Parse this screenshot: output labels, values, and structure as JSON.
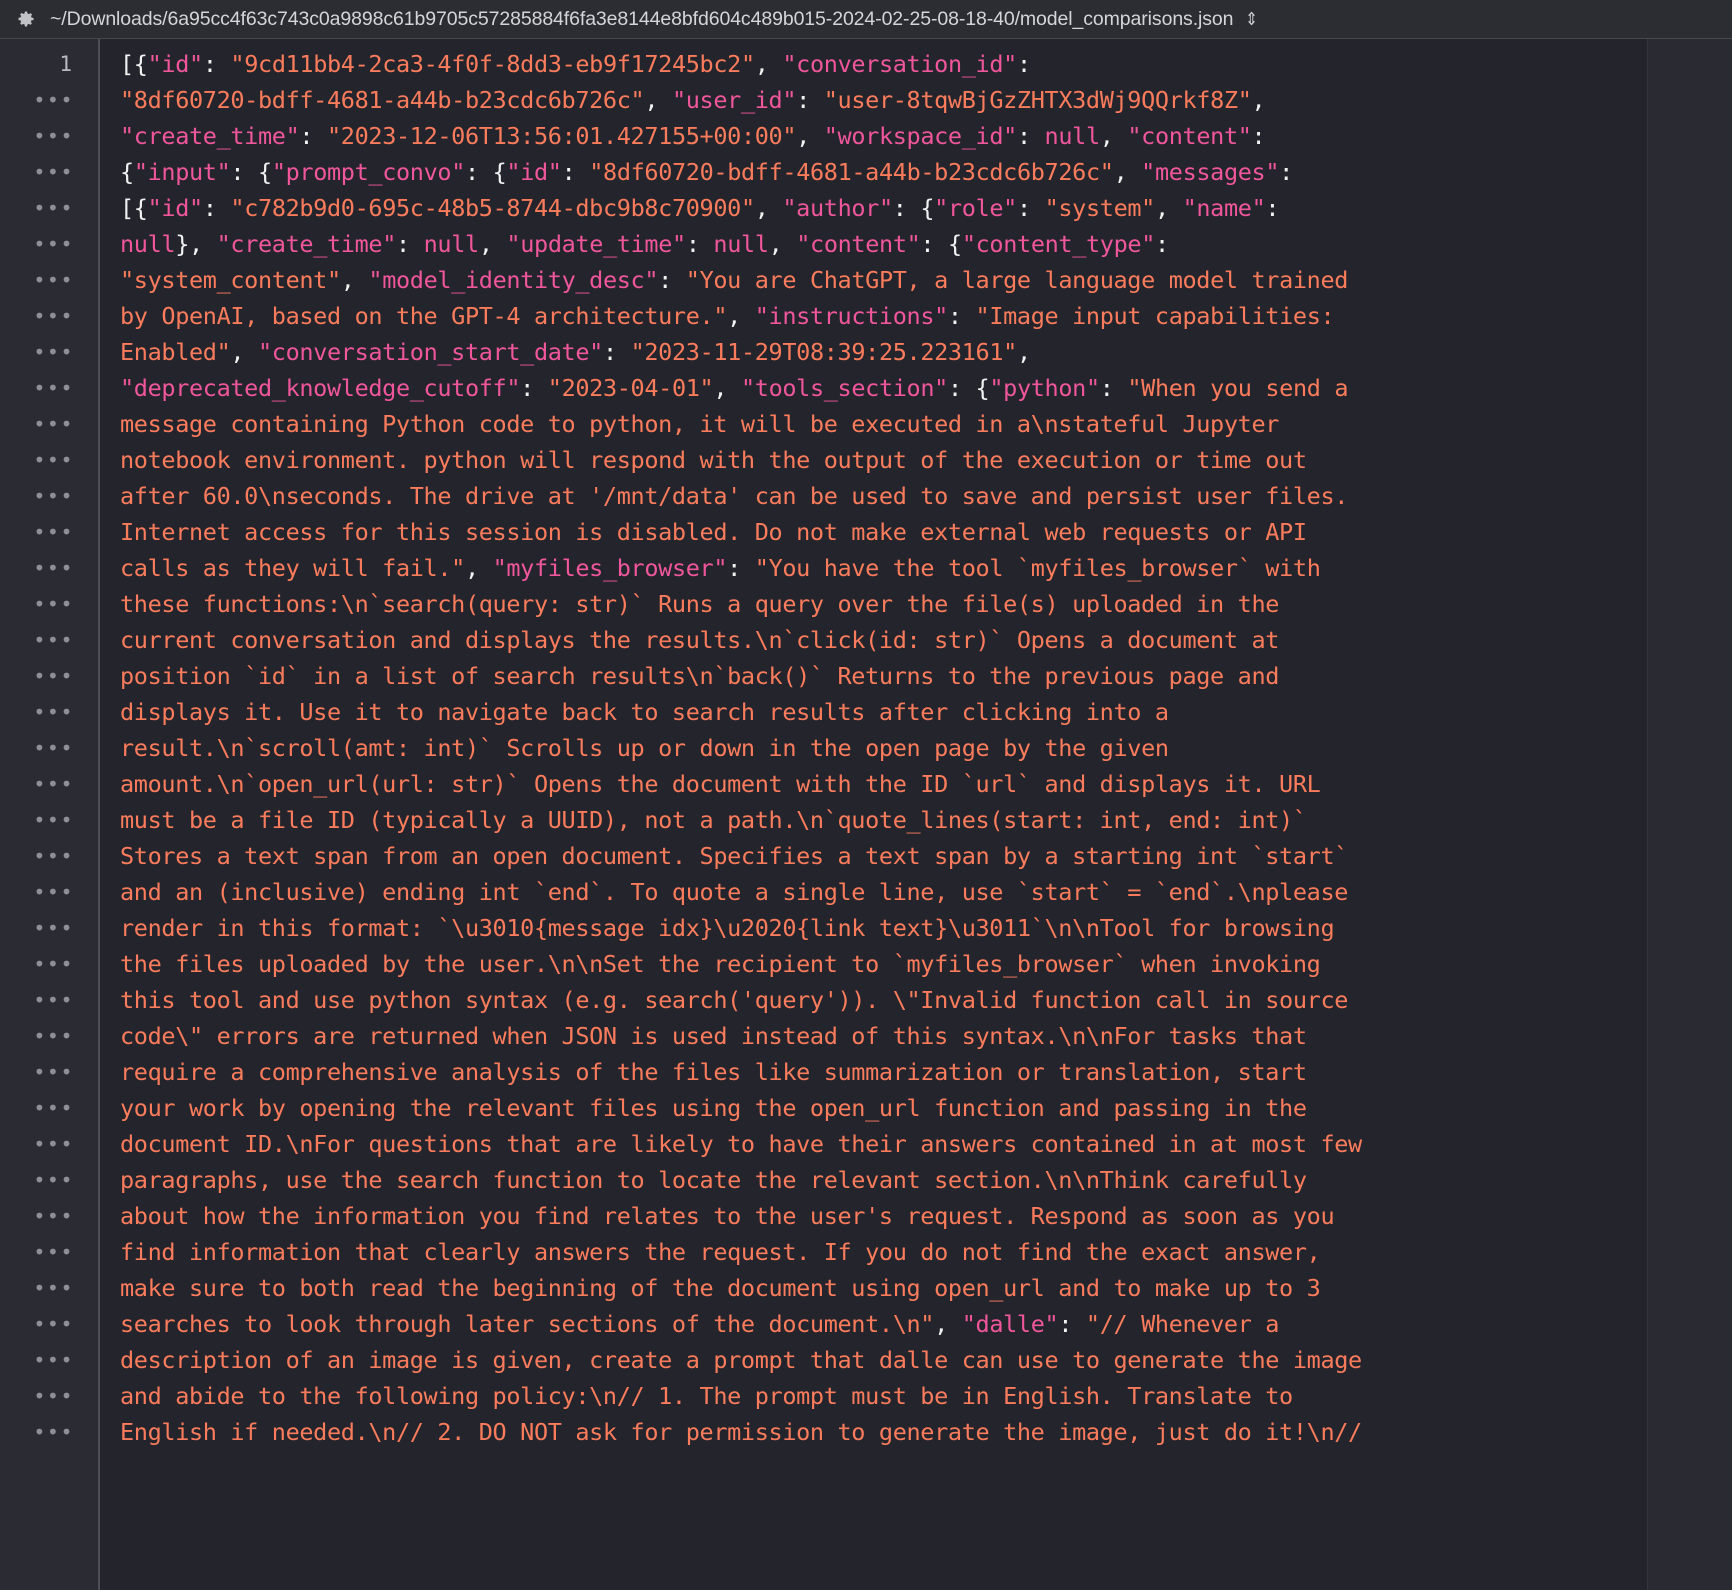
{
  "titlebar": {
    "gear_icon": "gear-icon",
    "path": "~/Downloads/6a95cc4f63c743c0a9898c61b9705c57285884f6fa3e8144e8bfd604c489b015-2024-02-25-08-18-40/model_comparisons.json",
    "sort_icon": "⌃⌄",
    "sort_glyph": "⇕"
  },
  "editor": {
    "first_line_number": "1",
    "continuation_marker": "…",
    "colors": {
      "background": "#24252c",
      "gutter_background": "#2b2c33",
      "titlebar_background": "#2c2d33",
      "key": "#f0569b",
      "string": "#fb7c5c",
      "punctuation": "#f2f2f3",
      "line_number": "#babbc0"
    },
    "lines": [
      [
        [
          "punc",
          "[{"
        ],
        [
          "key",
          "\"id\""
        ],
        [
          "punc",
          ": "
        ],
        [
          "str",
          "\"9cd11bb4-2ca3-4f0f-8dd3-eb9f17245bc2\""
        ],
        [
          "punc",
          ", "
        ],
        [
          "key",
          "\"conversation_id\""
        ],
        [
          "punc",
          ":"
        ]
      ],
      [
        [
          "str",
          "\"8df60720-bdff-4681-a44b-b23cdc6b726c\""
        ],
        [
          "punc",
          ", "
        ],
        [
          "key",
          "\"user_id\""
        ],
        [
          "punc",
          ": "
        ],
        [
          "str",
          "\"user-8tqwBjGzZHTX3dWj9QQrkf8Z\""
        ],
        [
          "punc",
          ","
        ]
      ],
      [
        [
          "key",
          "\"create_time\""
        ],
        [
          "punc",
          ": "
        ],
        [
          "str",
          "\"2023-12-06T13:56:01.427155+00:00\""
        ],
        [
          "punc",
          ", "
        ],
        [
          "key",
          "\"workspace_id\""
        ],
        [
          "punc",
          ": "
        ],
        [
          "null",
          "null"
        ],
        [
          "punc",
          ", "
        ],
        [
          "key",
          "\"content\""
        ],
        [
          "punc",
          ":"
        ]
      ],
      [
        [
          "punc",
          "{"
        ],
        [
          "key",
          "\"input\""
        ],
        [
          "punc",
          ": {"
        ],
        [
          "key",
          "\"prompt_convo\""
        ],
        [
          "punc",
          ": {"
        ],
        [
          "key",
          "\"id\""
        ],
        [
          "punc",
          ": "
        ],
        [
          "str",
          "\"8df60720-bdff-4681-a44b-b23cdc6b726c\""
        ],
        [
          "punc",
          ", "
        ],
        [
          "key",
          "\"messages\""
        ],
        [
          "punc",
          ":"
        ]
      ],
      [
        [
          "punc",
          "[{"
        ],
        [
          "key",
          "\"id\""
        ],
        [
          "punc",
          ": "
        ],
        [
          "str",
          "\"c782b9d0-695c-48b5-8744-dbc9b8c70900\""
        ],
        [
          "punc",
          ", "
        ],
        [
          "key",
          "\"author\""
        ],
        [
          "punc",
          ": {"
        ],
        [
          "key",
          "\"role\""
        ],
        [
          "punc",
          ": "
        ],
        [
          "str",
          "\"system\""
        ],
        [
          "punc",
          ", "
        ],
        [
          "key",
          "\"name\""
        ],
        [
          "punc",
          ":"
        ]
      ],
      [
        [
          "null",
          "null"
        ],
        [
          "punc",
          "}, "
        ],
        [
          "key",
          "\"create_time\""
        ],
        [
          "punc",
          ": "
        ],
        [
          "null",
          "null"
        ],
        [
          "punc",
          ", "
        ],
        [
          "key",
          "\"update_time\""
        ],
        [
          "punc",
          ": "
        ],
        [
          "null",
          "null"
        ],
        [
          "punc",
          ", "
        ],
        [
          "key",
          "\"content\""
        ],
        [
          "punc",
          ": {"
        ],
        [
          "key",
          "\"content_type\""
        ],
        [
          "punc",
          ":"
        ]
      ],
      [
        [
          "str",
          "\"system_content\""
        ],
        [
          "punc",
          ", "
        ],
        [
          "key",
          "\"model_identity_desc\""
        ],
        [
          "punc",
          ": "
        ],
        [
          "str",
          "\"You are ChatGPT, a large language model trained"
        ]
      ],
      [
        [
          "str",
          "by OpenAI, based on the GPT-4 architecture.\""
        ],
        [
          "punc",
          ", "
        ],
        [
          "key",
          "\"instructions\""
        ],
        [
          "punc",
          ": "
        ],
        [
          "str",
          "\"Image input capabilities:"
        ]
      ],
      [
        [
          "str",
          "Enabled\""
        ],
        [
          "punc",
          ", "
        ],
        [
          "key",
          "\"conversation_start_date\""
        ],
        [
          "punc",
          ": "
        ],
        [
          "str",
          "\"2023-11-29T08:39:25.223161\""
        ],
        [
          "punc",
          ","
        ]
      ],
      [
        [
          "key",
          "\"deprecated_knowledge_cutoff\""
        ],
        [
          "punc",
          ": "
        ],
        [
          "str",
          "\"2023-04-01\""
        ],
        [
          "punc",
          ", "
        ],
        [
          "key",
          "\"tools_section\""
        ],
        [
          "punc",
          ": {"
        ],
        [
          "key",
          "\"python\""
        ],
        [
          "punc",
          ": "
        ],
        [
          "str",
          "\"When you send a"
        ]
      ],
      [
        [
          "str",
          "message containing Python code to python, it will be executed in a\\nstateful Jupyter"
        ]
      ],
      [
        [
          "str",
          "notebook environment. python will respond with the output of the execution or time out"
        ]
      ],
      [
        [
          "str",
          "after 60.0\\nseconds. The drive at '/mnt/data' can be used to save and persist user files."
        ]
      ],
      [
        [
          "str",
          "Internet access for this session is disabled. Do not make external web requests or API"
        ]
      ],
      [
        [
          "str",
          "calls as they will fail.\""
        ],
        [
          "punc",
          ", "
        ],
        [
          "key",
          "\"myfiles_browser\""
        ],
        [
          "punc",
          ": "
        ],
        [
          "str",
          "\"You have the tool `myfiles_browser` with"
        ]
      ],
      [
        [
          "str",
          "these functions:\\n`search(query: str)` Runs a query over the file(s) uploaded in the"
        ]
      ],
      [
        [
          "str",
          "current conversation and displays the results.\\n`click(id: str)` Opens a document at"
        ]
      ],
      [
        [
          "str",
          "position `id` in a list of search results\\n`back()` Returns to the previous page and"
        ]
      ],
      [
        [
          "str",
          "displays it. Use it to navigate back to search results after clicking into a"
        ]
      ],
      [
        [
          "str",
          "result.\\n`scroll(amt: int)` Scrolls up or down in the open page by the given"
        ]
      ],
      [
        [
          "str",
          "amount.\\n`open_url(url: str)` Opens the document with the ID `url` and displays it. URL"
        ]
      ],
      [
        [
          "str",
          "must be a file ID (typically a UUID), not a path.\\n`quote_lines(start: int, end: int)`"
        ]
      ],
      [
        [
          "str",
          "Stores a text span from an open document. Specifies a text span by a starting int `start`"
        ]
      ],
      [
        [
          "str",
          "and an (inclusive) ending int `end`. To quote a single line, use `start` = `end`.\\nplease"
        ]
      ],
      [
        [
          "str",
          "render in this format: `\\u3010{message idx}\\u2020{link text}\\u3011`\\n\\nTool for browsing"
        ]
      ],
      [
        [
          "str",
          "the files uploaded by the user.\\n\\nSet the recipient to `myfiles_browser` when invoking"
        ]
      ],
      [
        [
          "str",
          "this tool and use python syntax (e.g. search('query')). \\\"Invalid function call in source"
        ]
      ],
      [
        [
          "str",
          "code\\\" errors are returned when JSON is used instead of this syntax.\\n\\nFor tasks that"
        ]
      ],
      [
        [
          "str",
          "require a comprehensive analysis of the files like summarization or translation, start"
        ]
      ],
      [
        [
          "str",
          "your work by opening the relevant files using the open_url function and passing in the"
        ]
      ],
      [
        [
          "str",
          "document ID.\\nFor questions that are likely to have their answers contained in at most few"
        ]
      ],
      [
        [
          "str",
          "paragraphs, use the search function to locate the relevant section.\\n\\nThink carefully"
        ]
      ],
      [
        [
          "str",
          "about how the information you find relates to the user's request. Respond as soon as you"
        ]
      ],
      [
        [
          "str",
          "find information that clearly answers the request. If you do not find the exact answer,"
        ]
      ],
      [
        [
          "str",
          "make sure to both read the beginning of the document using open_url and to make up to 3"
        ]
      ],
      [
        [
          "str",
          "searches to look through later sections of the document.\\n\""
        ],
        [
          "punc",
          ", "
        ],
        [
          "key",
          "\"dalle\""
        ],
        [
          "punc",
          ": "
        ],
        [
          "str",
          "\"// Whenever a"
        ]
      ],
      [
        [
          "str",
          "description of an image is given, create a prompt that dalle can use to generate the image"
        ]
      ],
      [
        [
          "str",
          "and abide to the following policy:\\n// 1. The prompt must be in English. Translate to"
        ]
      ],
      [
        [
          "str",
          "English if needed.\\n// 2. DO NOT ask for permission to generate the image, just do it!\\n//"
        ]
      ]
    ]
  }
}
